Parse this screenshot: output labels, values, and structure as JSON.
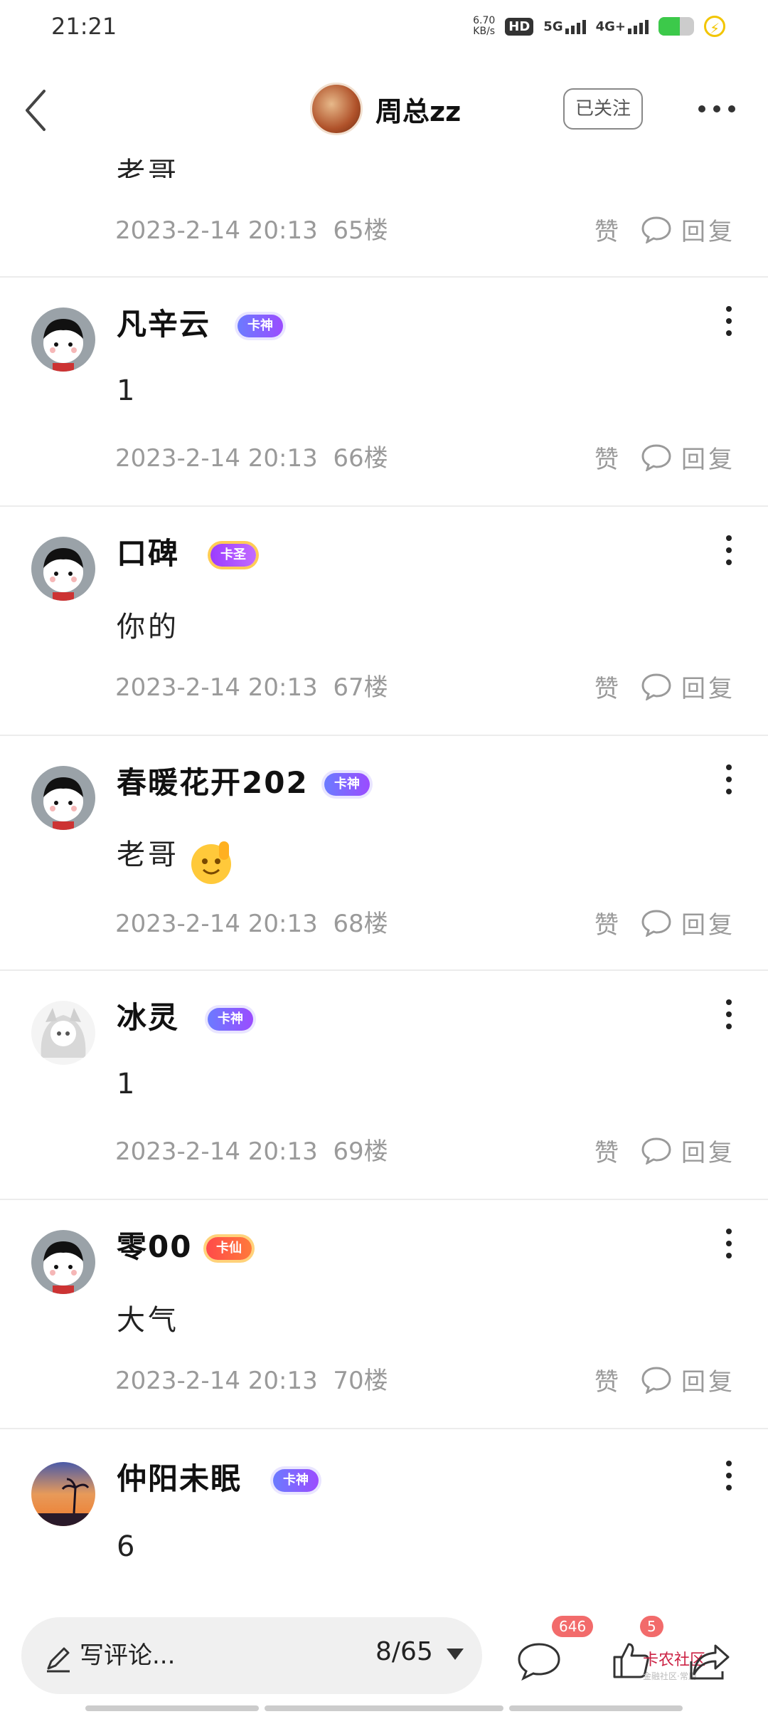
{
  "status_bar": {
    "time": "21:21",
    "net_speed": "6.70",
    "net_unit": "KB/s",
    "hd": "HD",
    "sim1": "1",
    "sim2": "2",
    "sig1": "5G",
    "sig2": "4G+"
  },
  "header": {
    "title": "周总zz",
    "follow_label": "已关注"
  },
  "comments": [
    {
      "content": "老哥",
      "timestamp": "2023-2-14 20:13",
      "floor": "65楼",
      "like_label": "赞",
      "reply_label": "回复"
    },
    {
      "name": "凡辛云",
      "badge": "卡神",
      "content": "1",
      "timestamp": "2023-2-14 20:13",
      "floor": "66楼",
      "like_label": "赞",
      "reply_label": "回复"
    },
    {
      "name": "口碑",
      "badge": "卡圣",
      "content": "你的",
      "timestamp": "2023-2-14 20:13",
      "floor": "67楼",
      "like_label": "赞",
      "reply_label": "回复"
    },
    {
      "name": "春暖花开202",
      "badge": "卡神",
      "content": "老哥",
      "timestamp": "2023-2-14 20:13",
      "floor": "68楼",
      "like_label": "赞",
      "reply_label": "回复"
    },
    {
      "name": "冰灵",
      "badge": "卡神",
      "content": "1",
      "timestamp": "2023-2-14 20:13",
      "floor": "69楼",
      "like_label": "赞",
      "reply_label": "回复"
    },
    {
      "name": "零00",
      "badge": "卡仙",
      "content": "大气",
      "timestamp": "2023-2-14 20:13",
      "floor": "70楼",
      "like_label": "赞",
      "reply_label": "回复"
    },
    {
      "name": "仲阳未眠",
      "badge": "卡神",
      "content": "6"
    }
  ],
  "bottom_bar": {
    "placeholder": "写评论...",
    "page": "8/65",
    "comment_count": "646",
    "like_count": "5",
    "watermark": "卡农社区",
    "watermark_sub": "金融社区·常用"
  }
}
